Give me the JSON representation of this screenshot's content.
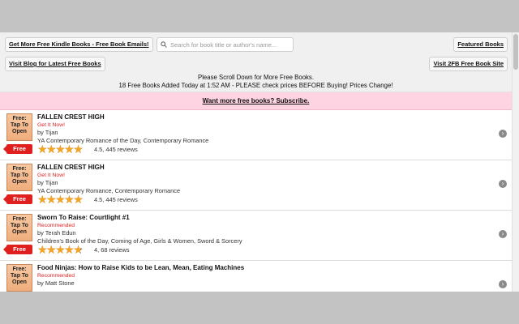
{
  "header": {
    "get_more_button": "Get More Free Kindle Books - Free Book Emails!",
    "blog_button": "Visit Blog for Latest Free Books",
    "featured_button": "Featured Books",
    "site_button": "Visit 2FB Free Book Site",
    "search_placeholder": "Search for book title or author's name...",
    "notice_line1": "Please Scroll Down for More Free Books.",
    "notice_line2": "18 Free Books Added Today at 1:52 AM - PLEASE check prices BEFORE Buying! Prices Change!"
  },
  "subscribe_link": "Want more free books? Subscribe.",
  "cover_text": {
    "line1": "Free:",
    "line2": "Tap To",
    "line3": "Open"
  },
  "free_badge": "Free",
  "books": [
    {
      "title": "FALLEN CREST HIGH",
      "status": "Get It Now!",
      "author": "by Tijan",
      "categories": "YA Contemporary Romance of the Day, Contemporary Romance",
      "rating": 4.5,
      "rating_text": "4.5, 445 reviews"
    },
    {
      "title": "FALLEN CREST HIGH",
      "status": "Get It Now!",
      "author": "by Tijan",
      "categories": "YA Contemporary Romance, Contemporary Romance",
      "rating": 4.5,
      "rating_text": "4.5, 445 reviews"
    },
    {
      "title": "Sworn To Raise: Courtlight #1",
      "status": "Recommended",
      "author": "by Terah Edun",
      "categories": "Children's Book of the Day, Coming of Age, Girls & Women, Sword & Sorcery",
      "rating": 4,
      "rating_text": "4, 68 reviews"
    },
    {
      "title": "Food Ninjas: How to Raise Kids to be Lean, Mean, Eating Machines",
      "status": "Recommended",
      "author": "by Matt Stone",
      "categories": "",
      "rating": null,
      "rating_text": ""
    }
  ],
  "icons": {
    "search": "search-icon",
    "chevron": "chevron-right-icon",
    "star": "star-icon"
  },
  "colors": {
    "accent_red": "#e01f1f",
    "subscribe_bg": "#ffd4e2",
    "star": "#f5a524"
  }
}
